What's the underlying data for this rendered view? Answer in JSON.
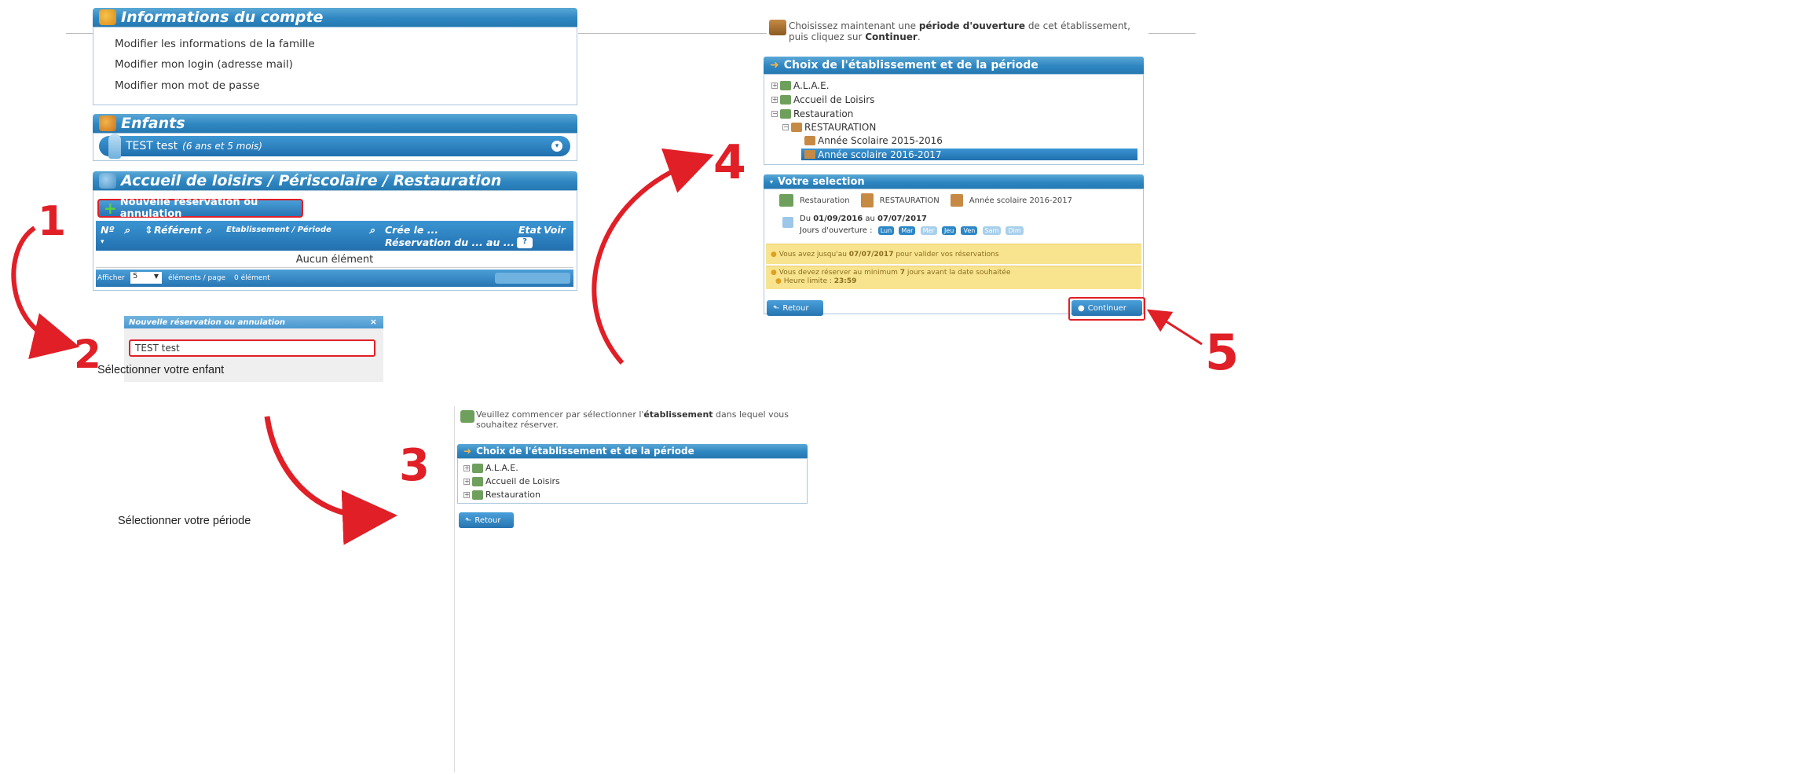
{
  "account": {
    "title": "Informations du compte",
    "links": [
      "Modifier les informations de la famille",
      "Modifier mon login (adresse mail)",
      "Modifier mon mot de passe"
    ]
  },
  "children": {
    "title": "Enfants",
    "child_name": "TEST test",
    "child_age": "(6 ans et 5 mois)"
  },
  "reservations": {
    "title": "Accueil de loisirs / Périscolaire / Restauration",
    "new_button": "Nouvelle réservation ou annulation",
    "columns": [
      "Nº",
      "Référent",
      "Etablissement / Période",
      "Crée le ...",
      "Réservation du ... au ...",
      "Etat",
      "Voir"
    ],
    "etat_help": "?",
    "empty": "Aucun élément",
    "footer_show": "Afficher",
    "footer_page_size": "5",
    "footer_per_page": "éléments / page",
    "footer_count": "0 élément"
  },
  "steps": {
    "s1": "1",
    "s2": "2",
    "s3": "3",
    "s4": "4",
    "s5": "5"
  },
  "popup": {
    "title": "Nouvelle réservation ou annulation",
    "close": "×",
    "child_value": "TEST test"
  },
  "captions": {
    "select_child": "Sélectionner votre enfant",
    "select_period": "Sélectionner votre période"
  },
  "establishment_panel": {
    "notice_pre": "Veuillez commencer par sélectionner l'",
    "notice_bold": "établissement",
    "notice_post": " dans lequel vous souhaitez réserver.",
    "head": "Choix de l'établissement et de la période",
    "items": [
      "A.L.A.E.",
      "Accueil de Loisirs",
      "Restauration"
    ],
    "back": "Retour"
  },
  "period_panel": {
    "notice_pre": "Choisissez maintenant une ",
    "notice_bold": "période d'ouverture",
    "notice_mid": " de cet établissement, puis cliquez sur ",
    "notice_bold2": "Continuer",
    "notice_end": ".",
    "head": "Choix de l'établissement et de la période",
    "items": [
      "A.L.A.E.",
      "Accueil de Loisirs",
      "Restauration",
      "RESTAURATION",
      "Année Scolaire 2015-2016",
      "Année scolaire 2016-2017"
    ],
    "selection_head": "Votre selection",
    "sel_1": "Restauration",
    "sel_2": "RESTAURATION",
    "sel_3": "Année scolaire 2016-2017",
    "dates_pre": "Du ",
    "date_from": "01/09/2016",
    "dates_mid": " au ",
    "date_to": "07/07/2017",
    "days_label": "Jours d'ouverture :",
    "days": [
      "Lun",
      "Mar",
      "Mer",
      "Jeu",
      "Ven",
      "Sam",
      "Dim"
    ],
    "warn1_pre": "Vous avez jusqu'au ",
    "warn1_bold": "07/07/2017",
    "warn1_post": " pour valider vos réservations",
    "warn2_pre": "Vous devez réserver au minimum ",
    "warn2_bold": "7",
    "warn2_post": " jours avant la date souhaitée",
    "warn2_line2": "Heure limite : ",
    "warn2_time": "23:59",
    "back": "Retour",
    "continue": "Continuer"
  },
  "colors": {
    "accent": "#2e86c1",
    "highlight": "#e01f27",
    "warning_bg": "#f8e48f"
  }
}
